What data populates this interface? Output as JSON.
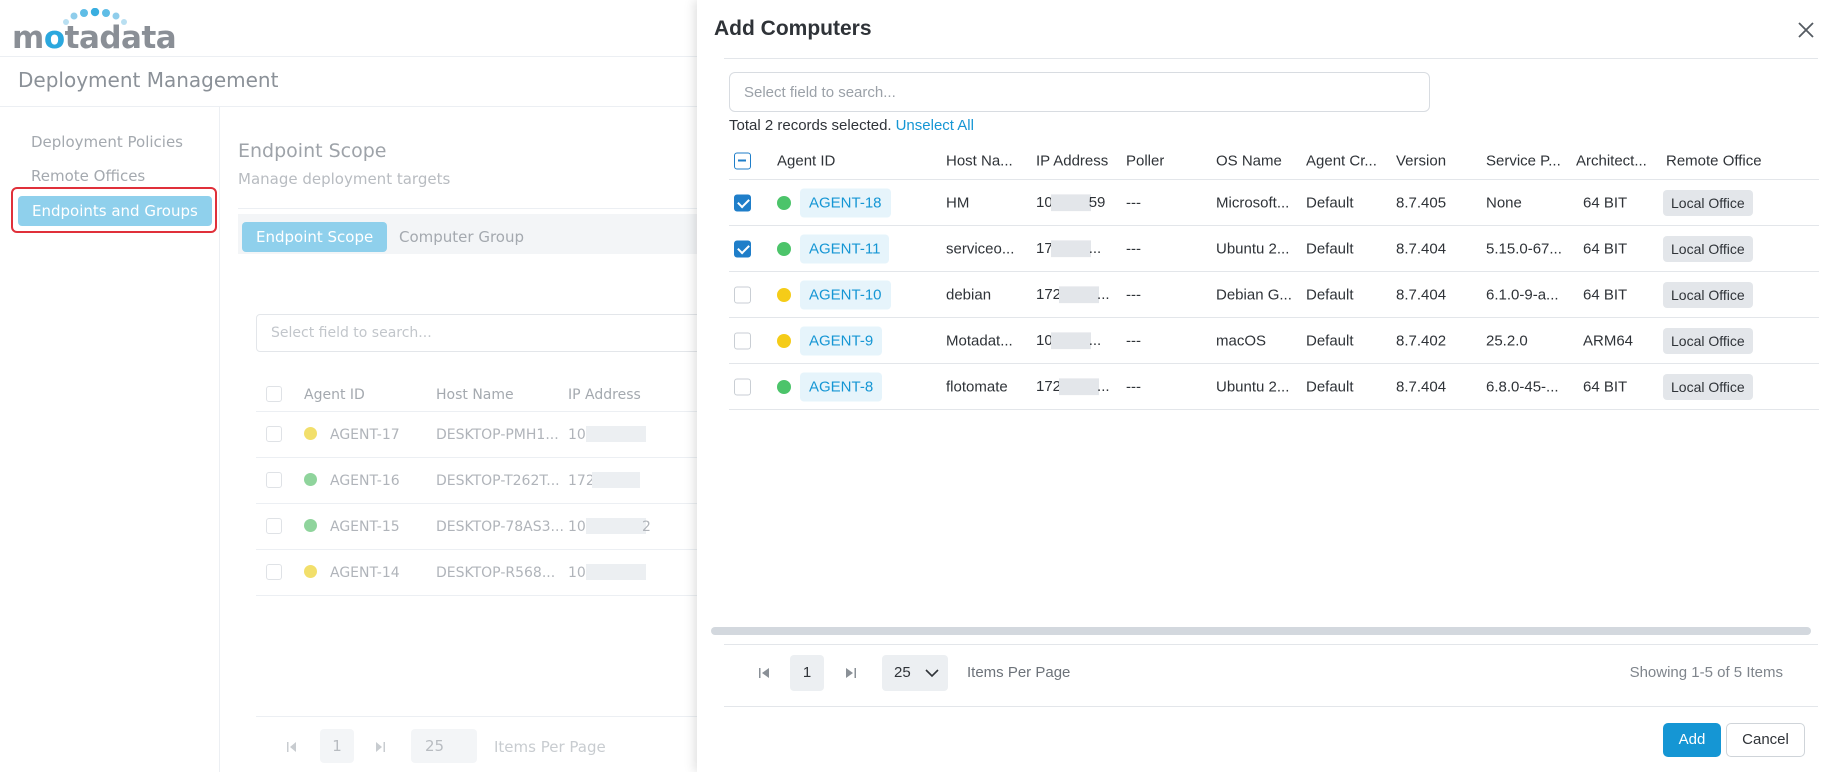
{
  "app": {
    "logo_text": "motadata",
    "page_title": "Deployment Management"
  },
  "left_nav": {
    "items": [
      {
        "label": "Deployment Policies"
      },
      {
        "label": "Remote Offices"
      },
      {
        "label": "Endpoints and Groups",
        "active": true
      }
    ]
  },
  "scope": {
    "title": "Endpoint Scope",
    "subtitle": "Manage deployment targets",
    "tabs": [
      "Endpoint Scope",
      "Computer Group"
    ],
    "search_placeholder": "Select field to search...",
    "columns": [
      "Agent ID",
      "Host Name",
      "IP Address"
    ],
    "rows": [
      {
        "agent": "AGENT-17",
        "host": "DESKTOP-PMH1...",
        "ip_prefix": "10",
        "ip_suffix": "",
        "status_color": "#f2df6b"
      },
      {
        "agent": "AGENT-16",
        "host": "DESKTOP-T262T...",
        "ip_prefix": "172",
        "ip_suffix": "",
        "status_color": "#8fd49c"
      },
      {
        "agent": "AGENT-15",
        "host": "DESKTOP-78AS3...",
        "ip_prefix": "10",
        "ip_suffix": "2",
        "status_color": "#8fd49c"
      },
      {
        "agent": "AGENT-14",
        "host": "DESKTOP-R568...",
        "ip_prefix": "10",
        "ip_suffix": "",
        "status_color": "#f2df6b"
      }
    ],
    "pager": {
      "page": "1",
      "per_page": "25",
      "items_per_page_label": "Items Per Page"
    }
  },
  "drawer": {
    "title": "Add Computers",
    "search_placeholder": "Select field to search...",
    "selection_text": "Total 2 records selected.",
    "unselect_label": "Unselect All",
    "columns": [
      "Agent ID",
      "Host Na...",
      "IP Address",
      "Poller",
      "OS Name",
      "Agent Cr...",
      "Version",
      "Service P...",
      "Architect...",
      "Remote Office"
    ],
    "rows": [
      {
        "checked": true,
        "status_color": "#4cc46a",
        "agent": "AGENT-18",
        "host": "HM",
        "ip_prefix": "10",
        "ip_suffix": "59",
        "poller": "---",
        "os": "Microsoft...",
        "creator": "Default",
        "version": "8.7.405",
        "service_pack": "None",
        "arch": "64 BIT",
        "office": "Local Office"
      },
      {
        "checked": true,
        "status_color": "#4cc46a",
        "agent": "AGENT-11",
        "host": "serviceo...",
        "ip_prefix": "17",
        "ip_suffix": "...",
        "poller": "---",
        "os": "Ubuntu 2...",
        "creator": "Default",
        "version": "8.7.404",
        "service_pack": "5.15.0-67...",
        "arch": "64 BIT",
        "office": "Local Office"
      },
      {
        "checked": false,
        "status_color": "#f5cc18",
        "agent": "AGENT-10",
        "host": "debian",
        "ip_prefix": "172",
        "ip_suffix": "...",
        "poller": "---",
        "os": "Debian G...",
        "creator": "Default",
        "version": "8.7.404",
        "service_pack": "6.1.0-9-a...",
        "arch": "64 BIT",
        "office": "Local Office"
      },
      {
        "checked": false,
        "status_color": "#f5cc18",
        "agent": "AGENT-9",
        "host": "Motadat...",
        "ip_prefix": "10",
        "ip_suffix": "...",
        "poller": "---",
        "os": "macOS",
        "creator": "Default",
        "version": "8.7.402",
        "service_pack": "25.2.0",
        "arch": "ARM64",
        "office": "Local Office"
      },
      {
        "checked": false,
        "status_color": "#4cc46a",
        "agent": "AGENT-8",
        "host": "flotomate",
        "ip_prefix": "172",
        "ip_suffix": "...",
        "poller": "---",
        "os": "Ubuntu 2...",
        "creator": "Default",
        "version": "8.7.404",
        "service_pack": "6.8.0-45-...",
        "arch": "64 BIT",
        "office": "Local Office"
      }
    ],
    "pager": {
      "page": "1",
      "per_page": "25",
      "items_per_page_label": "Items Per Page",
      "showing_text": "Showing 1-5 of 5 Items"
    },
    "add_label": "Add",
    "cancel_label": "Cancel"
  }
}
